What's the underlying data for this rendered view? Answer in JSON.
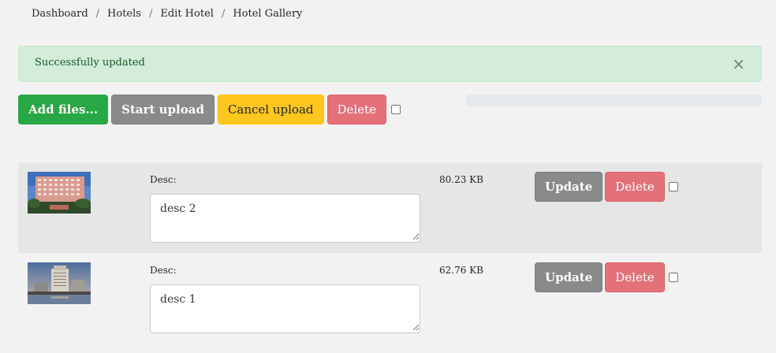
{
  "breadcrumb": {
    "items": [
      "Dashboard",
      "Hotels",
      "Edit Hotel",
      "Hotel Gallery"
    ],
    "separator": "/"
  },
  "alert": {
    "message": "Successfully updated",
    "close_label": "×"
  },
  "toolbar": {
    "add_files_label": "Add files...",
    "start_upload_label": "Start upload",
    "cancel_upload_label": "Cancel upload",
    "delete_label": "Delete"
  },
  "upload_progress": 0,
  "files": [
    {
      "desc_label": "Desc:",
      "desc_value": "desc 2",
      "size": "80.23 KB",
      "update_label": "Update",
      "delete_label": "Delete",
      "thumb_icon": "hotel-photo-modern-facade"
    },
    {
      "desc_label": "Desc:",
      "desc_value": "desc 1",
      "size": "62.76 KB",
      "update_label": "Update",
      "delete_label": "Delete",
      "thumb_icon": "hotel-photo-waterfront-tower"
    }
  ],
  "colors": {
    "success_bg": "#d4edda",
    "green": "#28a745",
    "grey": "#8a8a8a",
    "yellow": "#ffc61e",
    "red": "#e4717a"
  }
}
